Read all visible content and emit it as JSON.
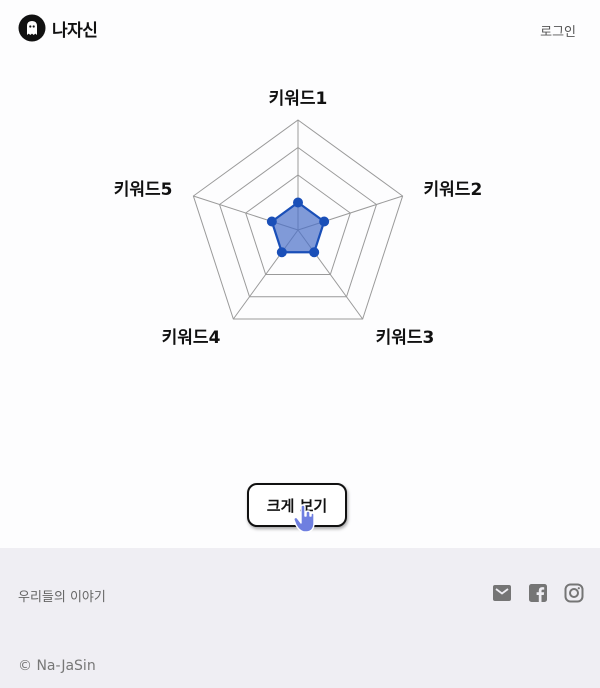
{
  "header": {
    "brand": "나자신",
    "login_label": "로그인"
  },
  "chart_data": {
    "type": "radar",
    "categories": [
      "키워드1",
      "키워드2",
      "키워드3",
      "키워드4",
      "키워드5"
    ],
    "values": [
      1,
      1,
      1,
      1,
      1
    ],
    "rlim": [
      0,
      4
    ],
    "rings": 4,
    "colors": {
      "fill": "#4a6fc8",
      "stroke": "#1a4fb8",
      "grid": "#9a9a9a"
    }
  },
  "main": {
    "view_button_label": "크게 보기"
  },
  "footer": {
    "story_label": "우리들의 이야기",
    "copyright": "© Na-JaSin"
  },
  "icons": [
    "ghost-logo-icon",
    "hand-pointer-icon",
    "mail-icon",
    "facebook-icon",
    "instagram-icon"
  ]
}
